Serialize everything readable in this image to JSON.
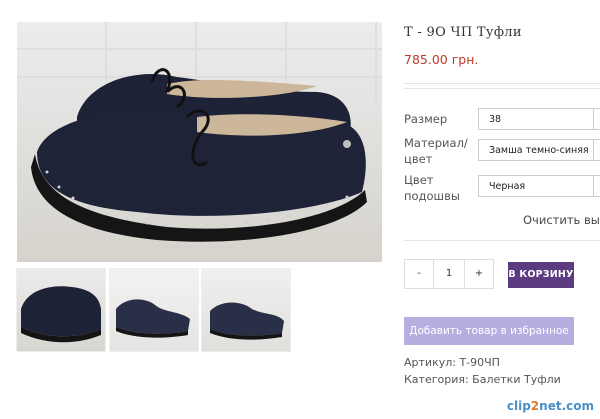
{
  "product": {
    "title": "Т - 9О ЧП Туфли",
    "price": "785.00 грн."
  },
  "options": [
    {
      "label_lines": [
        "Размер"
      ],
      "value": "38"
    },
    {
      "label_lines": [
        "Материал/",
        "цвет"
      ],
      "value": "Замша темно-синяя"
    },
    {
      "label_lines": [
        "Цвет",
        "подошвы"
      ],
      "value": "Черная"
    }
  ],
  "clear_label": "Очистить выбор",
  "quantity": {
    "minus": "-",
    "value": "1",
    "plus": "+"
  },
  "cart_label": "В КОРЗИНУ",
  "wishlist_label": "Добавить товар в избранное",
  "meta": {
    "sku": "Артикул: Т-90ЧП",
    "category": "Категория: Балетки Туфли"
  },
  "watermark": {
    "part1": "clip",
    "part2": "2",
    "part3": "net.com"
  },
  "colors": {
    "price": "#c0392b",
    "cart_button": "#5d3b80",
    "wishlist_button": "#b7aee0",
    "shoe": "#1e2236"
  }
}
